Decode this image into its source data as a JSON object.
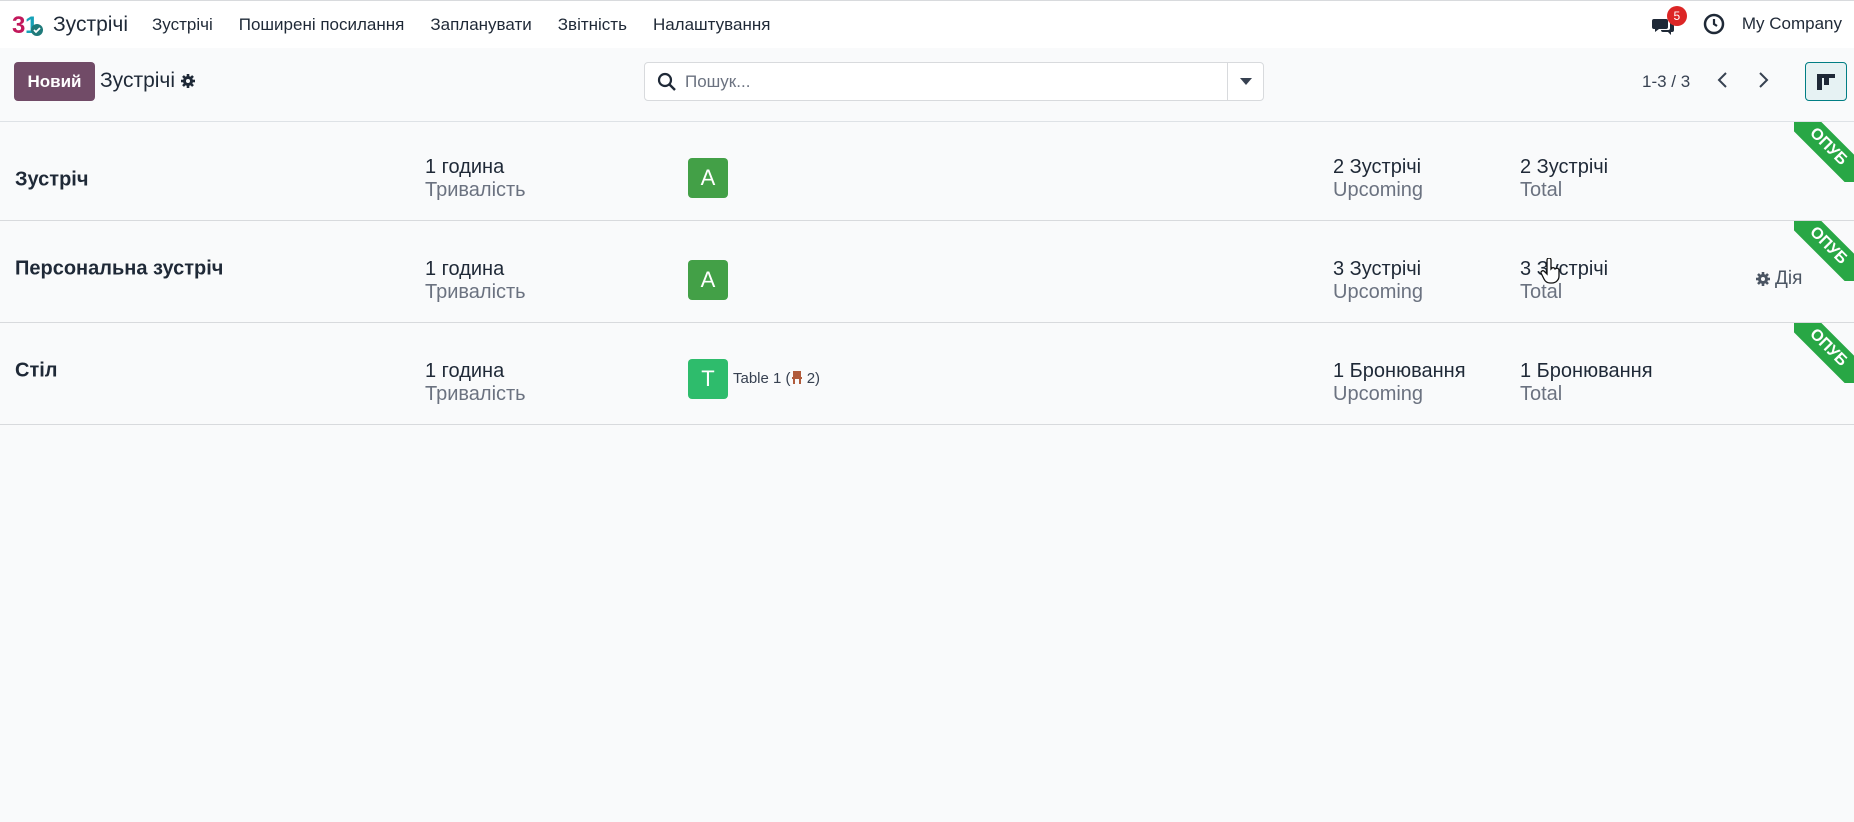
{
  "navbar": {
    "app_name": "Зустрічі",
    "menu": [
      "Зустрічі",
      "Поширені посилання",
      "Запланувати",
      "Звітність",
      "Налаштування"
    ],
    "chat_count": "5",
    "company": "My Company"
  },
  "control_panel": {
    "new_label": "Новий",
    "breadcrumb": "Зустрічі",
    "search_placeholder": "Пошук...",
    "pager": "1-3 / 3"
  },
  "rows": [
    {
      "title": "Зустріч",
      "duration": "1 година",
      "duration_label": "Тривалість",
      "avatar": "A",
      "avatar_color": "#43a047",
      "resource": "",
      "upcoming": "2 Зустрічі",
      "upcoming_label": "Upcoming",
      "total": "2 Зустрічі",
      "total_label": "Total",
      "ribbon": "ОПУБ"
    },
    {
      "title": "Персональна зустріч",
      "duration": "1 година",
      "duration_label": "Тривалість",
      "avatar": "A",
      "avatar_color": "#43a047",
      "resource": "",
      "upcoming": "3 Зустрічі",
      "upcoming_label": "Upcoming",
      "total": "3 Зустрічі",
      "total_label": "Total",
      "action": "Дія",
      "ribbon": "ОПУБ"
    },
    {
      "title": "Стіл",
      "duration": "1 година",
      "duration_label": "Тривалість",
      "avatar": "T",
      "avatar_color": "#2ebc6c",
      "resource_name": "Table 1 (",
      "resource_capacity": " 2)",
      "upcoming": "1 Бронювання",
      "upcoming_label": "Upcoming",
      "total": "1 Бронювання",
      "total_label": "Total",
      "ribbon": "ОПУБ"
    }
  ],
  "colors": {
    "brand": "#714b67",
    "accent": "#017e84",
    "ribbon": "#28a745",
    "badge": "#dc2626"
  }
}
